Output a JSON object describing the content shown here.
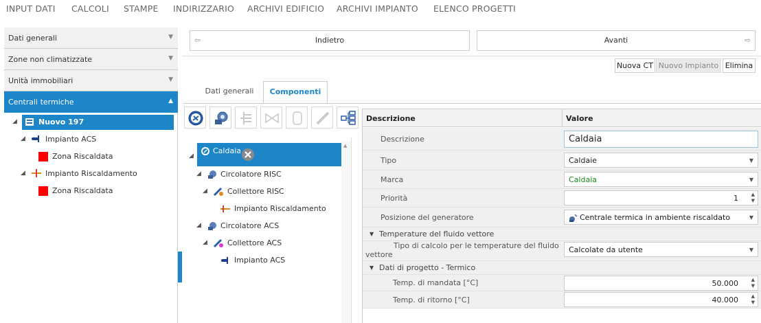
{
  "menu": [
    "INPUT DATI",
    "CALCOLI",
    "STAMPE",
    "INDIRIZZARIO",
    "ARCHIVI EDIFICIO",
    "ARCHIVI IMPIANTO",
    "ELENCO PROGETTI"
  ],
  "left": {
    "sections": [
      "Dati generali",
      "Zone non climatizzate",
      "Unità immobiliari",
      "Centrali termiche"
    ],
    "tree": {
      "root": "Nuovo 197",
      "acs": "Impianto ACS",
      "acs_zone": "Zona Riscaldata",
      "risc": "Impianto Riscaldamento",
      "risc_zone": "Zona Riscaldata"
    }
  },
  "nav": {
    "back": "Indietro",
    "next": "Avanti"
  },
  "actions": {
    "new_ct": "Nuova CT",
    "new_impianto": "Nuovo Impianto",
    "delete": "Elimina"
  },
  "tabs": {
    "general": "Dati generali",
    "components": "Componenti"
  },
  "components": {
    "caldaia": "Caldaia",
    "circ_risc": "Circolatore RISC",
    "coll_risc": "Collettore RISC",
    "imp_risc": "Impianto Riscaldamento",
    "circ_acs": "Circolatore ACS",
    "coll_acs": "Collettore ACS",
    "imp_acs": "Impianto ACS"
  },
  "grid": {
    "col_desc": "Descrizione",
    "col_val": "Valore",
    "rows": {
      "descrizione": {
        "name": "Descrizione",
        "value": "Caldaia"
      },
      "tipo": {
        "name": "Tipo",
        "value": "Caldaie"
      },
      "marca": {
        "name": "Marca",
        "value": "Caldaia"
      },
      "priorita": {
        "name": "Priorità",
        "value": "1"
      },
      "posizione": {
        "name": "Posizione del generatore",
        "value": "Centrale termica in ambiente riscaldato"
      },
      "tipo_calcolo": {
        "name_1": "Tipo di calcolo per le temperature del fluido",
        "name_2": "vettore",
        "value": "Calcolate da utente"
      },
      "mandata": {
        "name": "Temp. di mandata [°C]",
        "value": "50.000"
      },
      "ritorno": {
        "name": "Temp. di ritorno [°C]",
        "value": "40.000"
      }
    },
    "sections": {
      "fluido": "Temperature del fluido vettore",
      "progetto": "Dati di progetto - Termico"
    }
  },
  "colors": {
    "accent": "#1c86c8",
    "zone": "#ff0000",
    "marca_text": "#1a8a1a"
  }
}
